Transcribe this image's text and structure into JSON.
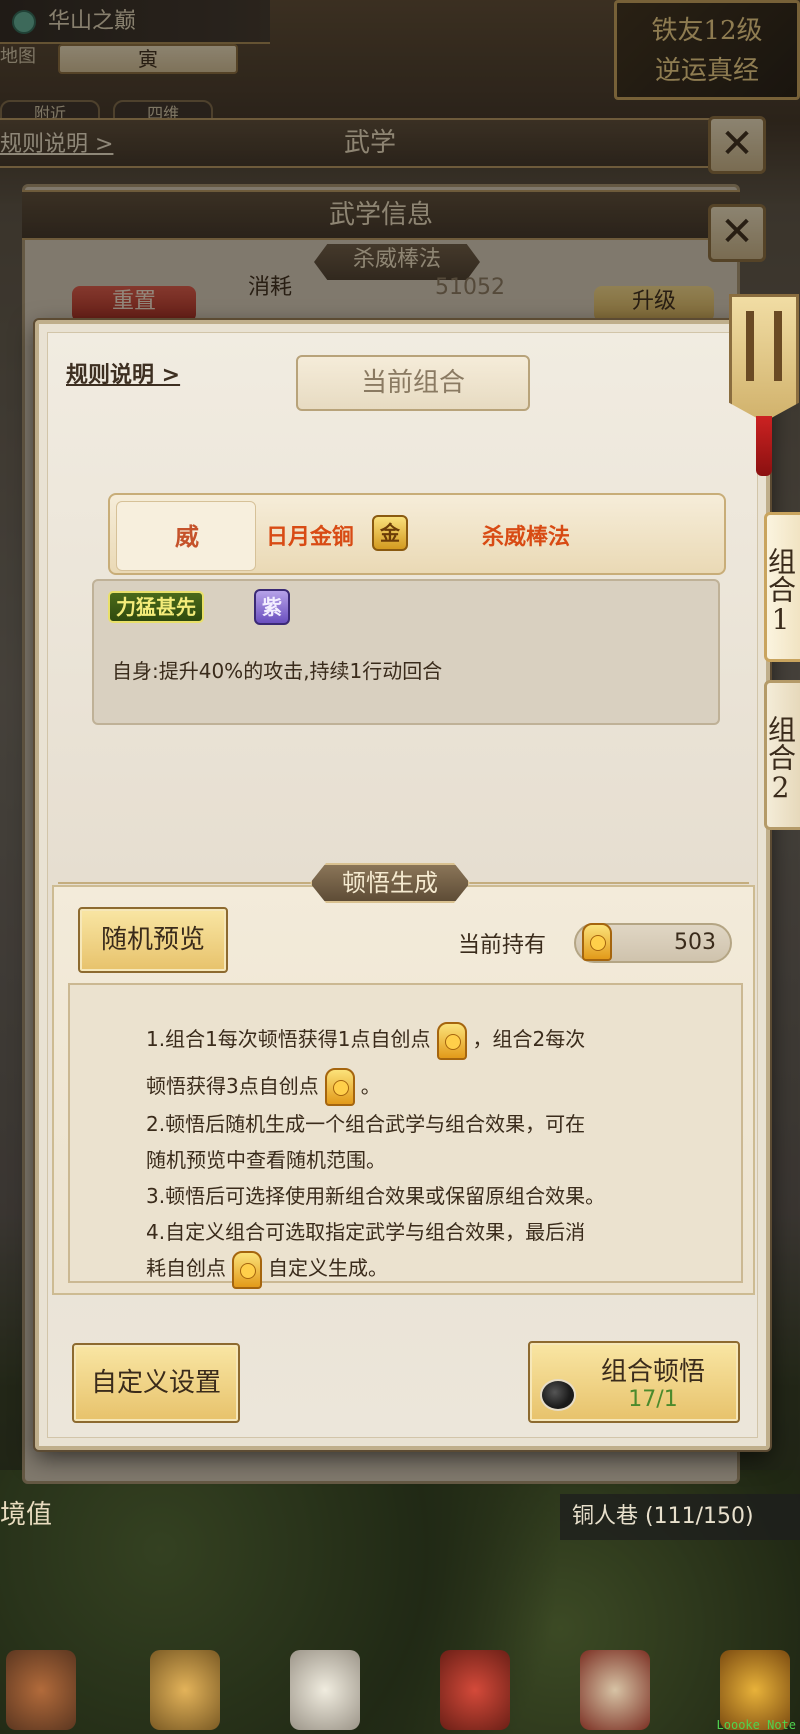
{
  "background": {
    "location": "华山之巅",
    "map_label": "地图",
    "time_label": "寅",
    "top_buttons": [
      "附近",
      "四维"
    ],
    "banner_line1": "铁友12级",
    "banner_line2": "逆运真经",
    "layer1_title": "武学",
    "layer1_rule_link": "规则说明 >",
    "layer2_title": "武学信息",
    "layer2_subtitle": "杀威棒法",
    "reset_label": "重置",
    "upgrade_label": "升级",
    "cost_label": "消耗",
    "cost_value": "51052",
    "bottom_value_label": "境值",
    "bottom_location": "铜人巷 (111/150)"
  },
  "modal": {
    "rule_link": "规则说明 >",
    "current_combo_title": "当前组合",
    "side_tabs": [
      {
        "label": "组合1",
        "active": true
      },
      {
        "label": "组合2",
        "active": false
      }
    ],
    "combo": {
      "chip_label": "威",
      "art1": "日月金锏",
      "grade_badge": "金",
      "art2": "杀威棒法"
    },
    "effect": {
      "name": "力猛甚先",
      "grade_badge": "紫",
      "description": "自身:提升40%的攻击,持续1行动回合"
    },
    "generation": {
      "section_title": "顿悟生成",
      "random_preview_label": "随机预览",
      "holding_label": "当前持有",
      "holding_value": "503",
      "rules": {
        "line1a": "1.组合1每次顿悟获得1点自创点",
        "line1b": "，组合2每次",
        "line2a": "顿悟获得3点自创点",
        "line2b": "。",
        "line3": "2.顿悟后随机生成一个组合武学与组合效果，可在",
        "line4": "随机预览中查看随机范围。",
        "line5": "3.顿悟后可选择使用新组合效果或保留原组合效果。",
        "line6": "4.自定义组合可选取指定武学与组合效果，最后消",
        "line7a": "耗自创点",
        "line7b": "自定义生成。"
      }
    },
    "custom_settings_label": "自定义设置",
    "comprehend_label": "组合顿悟",
    "comprehend_count": "17/1"
  },
  "colors": {
    "accent_gold": "#e7c26b",
    "combo_red": "#d84b14",
    "effect_green": "#f4ec7a",
    "count_green": "#4b8a2c"
  },
  "icons": [
    "location-pin-icon",
    "close-icon",
    "bookmark-icon",
    "gold-grade-icon",
    "purple-grade-icon",
    "creation-point-coin-icon",
    "ink-icon"
  ],
  "watermark": "Loooke Note"
}
